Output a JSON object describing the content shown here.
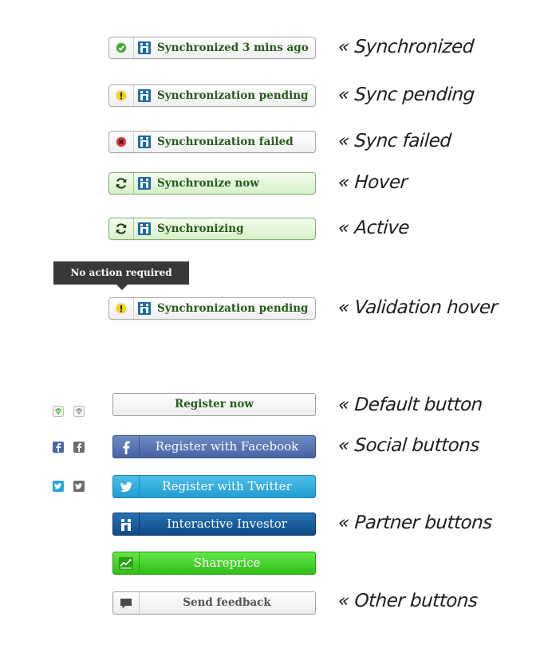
{
  "status_buttons": [
    {
      "label": "Synchronized 3 mins ago",
      "status_icon": "check-icon",
      "note": "« Synchronized"
    },
    {
      "label": "Synchronization pending",
      "status_icon": "warning-icon",
      "note": "« Sync pending"
    },
    {
      "label": "Synchronization failed",
      "status_icon": "error-icon",
      "note": "« Sync failed"
    },
    {
      "label": "Synchronize now",
      "status_icon": "refresh-icon",
      "note": "« Hover"
    },
    {
      "label": "Synchronizing",
      "status_icon": "refresh-icon",
      "note": "« Active"
    },
    {
      "label": "Synchronization pending",
      "status_icon": "warning-icon",
      "note": "« Validation hover"
    }
  ],
  "tooltip": {
    "text": "No action required"
  },
  "action_buttons": {
    "default": {
      "label": "Register now",
      "note": "« Default button"
    },
    "facebook": {
      "label": "Register with Facebook",
      "note": "« Social buttons"
    },
    "twitter": {
      "label": "Register with Twitter"
    },
    "interactive_investor": {
      "label": "Interactive Investor",
      "note": "« Partner buttons"
    },
    "shareprice": {
      "label": "Shareprice"
    },
    "feedback": {
      "label": "Send feedback",
      "note": "« Other buttons"
    }
  },
  "icons": {
    "partner_icon": "interactive-investor-icon",
    "facebook_icon": "facebook-icon",
    "twitter_icon": "twitter-icon",
    "shareprice_icon": "shareprice-icon",
    "feedback_icon": "speech-bubble-icon"
  },
  "colors": {
    "sync_text": "#275a1c",
    "facebook": "#4663a3",
    "twitter": "#219ed3",
    "interactive_investor": "#0f4a85",
    "shareprice": "#2fbe16",
    "tooltip_bg": "#383838"
  }
}
